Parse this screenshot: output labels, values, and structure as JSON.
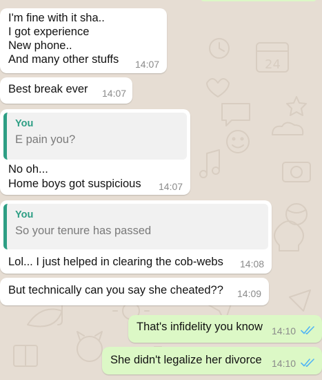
{
  "colors": {
    "wallpaper": "#e6ddd3",
    "incoming_bubble": "#ffffff",
    "outgoing_bubble": "#dcf8c6",
    "quote_accent": "#2d9e84",
    "read_ticks": "#4fb3f6"
  },
  "messages": [
    {
      "direction": "incoming",
      "lines": [
        "I'm fine with it sha..",
        "I got experience",
        "New phone..",
        "And many other stuffs"
      ],
      "time": "14:07"
    },
    {
      "direction": "incoming",
      "lines": [
        "Best break ever"
      ],
      "time": "14:07"
    },
    {
      "direction": "incoming",
      "reply_to": {
        "author": "You",
        "text": "E pain you?"
      },
      "lines": [
        "No oh...",
        "Home boys got suspicious"
      ],
      "time": "14:07"
    },
    {
      "direction": "incoming",
      "reply_to": {
        "author": "You",
        "text": "So your tenure has passed"
      },
      "lines": [
        "Lol... I just helped in clearing the cob-webs"
      ],
      "time": "14:08"
    },
    {
      "direction": "incoming",
      "lines": [
        "But technically can you say she cheated??"
      ],
      "time": "14:09"
    },
    {
      "direction": "outgoing",
      "lines": [
        "That's infidelity you know"
      ],
      "time": "14:10",
      "status_icon": "double-check-read-icon"
    },
    {
      "direction": "outgoing",
      "lines": [
        "She didn't legalize her divorce"
      ],
      "time": "14:10",
      "status_icon": "double-check-read-icon"
    }
  ]
}
